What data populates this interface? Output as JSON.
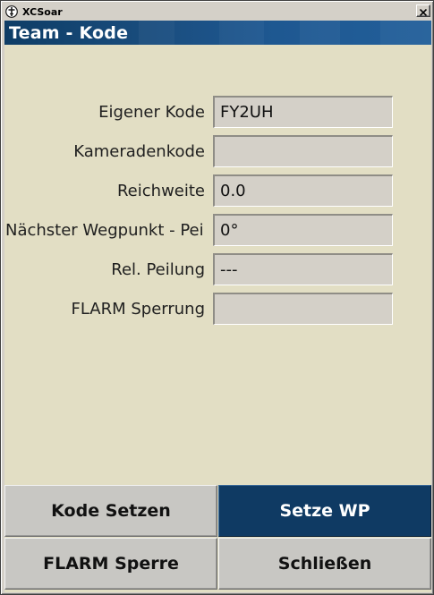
{
  "window": {
    "title": "XCSoar",
    "close_glyph": "✕"
  },
  "dialog": {
    "caption": "Team - Kode"
  },
  "fields": [
    {
      "label": "Eigener Kode",
      "value": "FY2UH"
    },
    {
      "label": "Kameradenkode",
      "value": ""
    },
    {
      "label": "Reichweite",
      "value": "0.0"
    },
    {
      "label": "Nächster Wegpunkt - Pei",
      "value": "0°"
    },
    {
      "label": "Rel. Peilung",
      "value": "---"
    },
    {
      "label": "FLARM Sperrung",
      "value": ""
    }
  ],
  "buttons": {
    "set_code": "Kode Setzen",
    "set_wp": "Setze WP",
    "flarm_lock": "FLARM Sperre",
    "close": "Schließen"
  },
  "colors": {
    "caption_bg": "#1a4d7e",
    "dialog_bg": "#e2dec4",
    "field_bg": "#d4d0c8",
    "button_bg": "#c8c7c3",
    "button_selected_bg": "#0f3a63"
  },
  "icons": {
    "app": "xcsoar-app-icon",
    "close": "close-icon"
  }
}
